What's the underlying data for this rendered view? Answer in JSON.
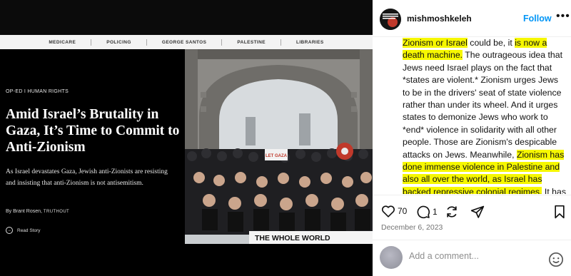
{
  "nav": {
    "items": [
      "MEDICARE",
      "POLICING",
      "GEORGE SANTOS",
      "PALESTINE",
      "LIBRARIES"
    ]
  },
  "article": {
    "kicker": "OP-ED I HUMAN RIGHTS",
    "headline": "Amid Israel’s Brutality in Gaza, It’s Time to Commit to Anti-Zionism",
    "dek": "As Israel devastates Gaza, Jewish anti-Zionists are resisting and insisting that anti-Zionism is not antisemitism.",
    "byline_prefix": "By Brant Rosen,",
    "publication": "TRUTHOUT",
    "read_story": "Read Story"
  },
  "photo": {
    "banner_text": "THE WHOLE WORLD",
    "sign_text": "LET GAZA"
  },
  "post": {
    "username": "mishmoshkeleh",
    "follow_label": "Follow",
    "avatar_text": [
      "ANTI",
      "OCCUPATION",
      "LEAGUE"
    ],
    "caption_segments": [
      {
        "text": "Zionism or Israel",
        "hl": true
      },
      {
        "text": " could be, it ",
        "hl": false
      },
      {
        "text": "is now a death machine.",
        "hl": true
      },
      {
        "text": " The outrageous idea that Jews need Israel plays on the fact that *states are violent.* Zionism urges Jews to be in the drivers' seat of state violence rather than under its wheel. And it urges states to demonize Jews who work to *end* violence in solidarity with all other people. Those are Zionism's despicable attacks on Jews. Meanwhile, ",
        "hl": false
      },
      {
        "text": "Zionism has done immense violence in Palestine and also all over the world, as Israel has backed repressive colonial regimes.",
        "hl": true
      },
      {
        "text": " It has",
        "hl": false
      }
    ],
    "likes": "70",
    "comments": "1",
    "date": "December 6, 2023",
    "comment_placeholder": "Add a comment...",
    "more_label": "•••"
  }
}
